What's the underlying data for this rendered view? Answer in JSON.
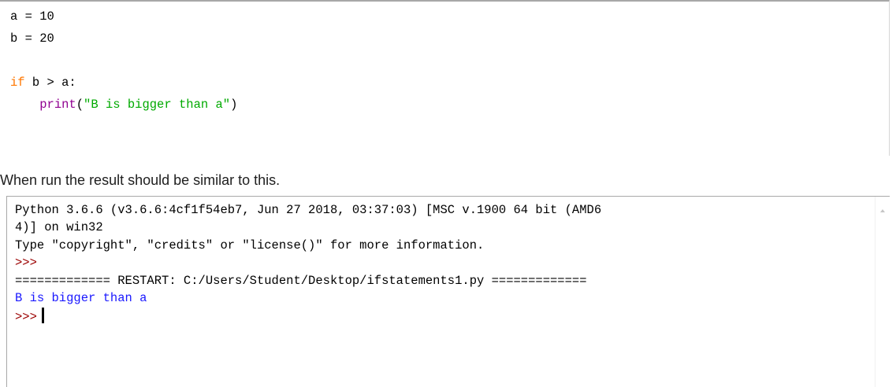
{
  "editor": {
    "line1": "a = 10",
    "line2": "b = 20",
    "if_kw": "if",
    "cond": " b > a:",
    "indent": "    ",
    "print_fn": "print",
    "paren_open": "(",
    "print_str": "\"B is bigger than a\"",
    "paren_close": ")"
  },
  "caption": "When run the result should be similar to this.",
  "shell": {
    "line1": "Python 3.6.6 (v3.6.6:4cf1f54eb7, Jun 27 2018, 03:37:03) [MSC v.1900 64 bit (AMD6",
    "line2": "4)] on win32",
    "line3": "Type \"copyright\", \"credits\" or \"license()\" for more information.",
    "prompt": ">>>",
    "restart": "============= RESTART: C:/Users/Student/Desktop/ifstatements1.py =============",
    "output": "B is bigger than a"
  },
  "colors": {
    "keyword": "#ff7700",
    "builtin": "#900090",
    "string": "#00aa00",
    "prompt": "#9b0000",
    "output": "#1a18ff"
  }
}
